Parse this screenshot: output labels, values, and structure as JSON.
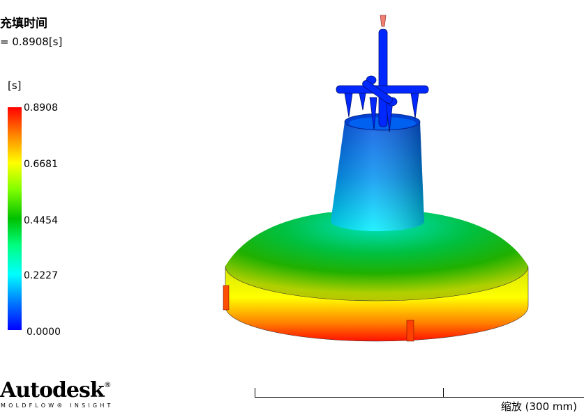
{
  "result": {
    "title": "充填时间",
    "time_readout": "= 0.8908[s]"
  },
  "legend": {
    "unit": "[s]",
    "ticks": [
      "0.8908",
      "0.6681",
      "0.4454",
      "0.2227",
      "0.0000"
    ],
    "max": 0.8908,
    "min": 0.0
  },
  "branding": {
    "logo": "Autodesk",
    "registered": "®",
    "product": "MOLDFLOW® INSIGHT"
  },
  "scale_bar": {
    "label": "缩放 (300 mm)"
  },
  "colors": {
    "part_blue": "#0028ff",
    "hot": "#ff0000",
    "cold": "#0000ff"
  }
}
